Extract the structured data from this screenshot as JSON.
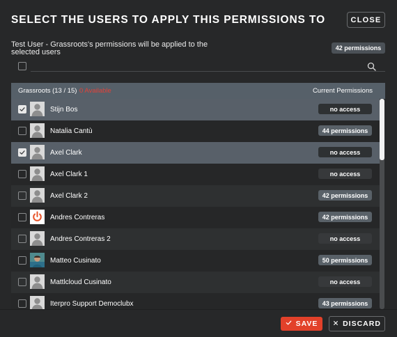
{
  "header": {
    "title": "SELECT THE USERS TO APPLY THIS PERMISSIONS TO",
    "close_label": "CLOSE"
  },
  "description": "Test User - Grassroots's permissions will be applied to the selected users",
  "total_badge": "42 permissions",
  "search": {
    "placeholder": "",
    "value": ""
  },
  "list": {
    "group_name": "Grassroots (13 / 15)",
    "group_warning": "0 Available",
    "column_header": "Current Permissions",
    "rows": [
      {
        "name": "Stijn Bos",
        "checked": true,
        "selected": true,
        "permissions": "no access",
        "avatar": "default-avatar"
      },
      {
        "name": "Natalia Cantù",
        "checked": false,
        "selected": false,
        "permissions": "44 permissions",
        "avatar": "default-avatar"
      },
      {
        "name": "Axel Clark",
        "checked": true,
        "selected": true,
        "permissions": "no access",
        "avatar": "default-avatar"
      },
      {
        "name": "Axel Clark 1",
        "checked": false,
        "selected": false,
        "permissions": "no access",
        "avatar": "default-avatar"
      },
      {
        "name": "Axel Clark 2",
        "checked": false,
        "selected": false,
        "permissions": "42 permissions",
        "avatar": "default-avatar"
      },
      {
        "name": "Andres Contreras",
        "checked": false,
        "selected": false,
        "permissions": "42 permissions",
        "avatar": "power-logo"
      },
      {
        "name": "Andres Contreras 2",
        "checked": false,
        "selected": false,
        "permissions": "no access",
        "avatar": "default-avatar"
      },
      {
        "name": "Matteo Cusinato",
        "checked": false,
        "selected": false,
        "permissions": "50 permissions",
        "avatar": "photo-avatar"
      },
      {
        "name": "Mattlcloud Cusinato",
        "checked": false,
        "selected": false,
        "permissions": "no access",
        "avatar": "default-avatar"
      },
      {
        "name": "Iterpro Support Democlubx",
        "checked": false,
        "selected": false,
        "permissions": "43 permissions",
        "avatar": "default-avatar"
      }
    ]
  },
  "footer": {
    "save_label": "SAVE",
    "discard_label": "DISCARD"
  },
  "colors": {
    "background": "#272829",
    "accent_save": "#e2412a",
    "warning": "#e0423a",
    "row_selected": "#586069",
    "badge_has": "#596168",
    "badge_none": "#37393b"
  },
  "icons": {
    "search": "search-icon",
    "check": "check-icon",
    "close": "x-icon"
  }
}
